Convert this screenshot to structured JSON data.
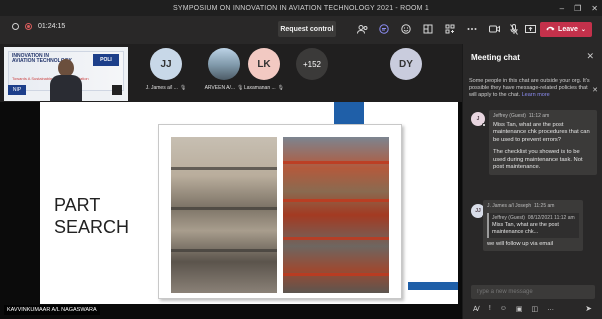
{
  "window": {
    "title": "SYMPOSIUM ON INNOVATION IN AVIATION TECHNOLOGY 2021 - ROOM 1",
    "controls": [
      "–",
      "❐",
      "✕"
    ]
  },
  "toolbar": {
    "timer": "01:24:15",
    "request_control_label": "Request control",
    "leave_label": "Leave",
    "icons": [
      "people-icon",
      "chat-icon",
      "reactions-icon",
      "rooms-icon",
      "apps-icon",
      "more-icon",
      "camera-icon",
      "mic-icon",
      "share-icon"
    ]
  },
  "self_tile": {
    "banner_title": "INNOVATION IN AVIATION TECHNOLOGY",
    "banner_logo": "POLI",
    "banner_sub": "Towards A Sustainable ... Future in Aviation",
    "logo_left": "NIP"
  },
  "participants": [
    {
      "initials": "JJ",
      "name": "J. James a/l ...",
      "color": "#c8d8e8"
    },
    {
      "initials": "",
      "name": "ARVEEN A/...",
      "color": "#9fb3c3"
    },
    {
      "initials": "LK",
      "name": "Laxamanan ...",
      "color": "#f2c9c2"
    }
  ],
  "overflow_count": "+152",
  "right_avatar": {
    "initials": "DY",
    "color": "#c9ccdd"
  },
  "slide": {
    "title_line1": "PART",
    "title_line2": "SEARCH",
    "presenter_label": "KAVVINKUMAAR A/L NAGASWARA"
  },
  "chat": {
    "header": "Meeting chat",
    "notice": "Some people in this chat are outside your org. It's possible they have message-related policies that will apply to the chat.",
    "notice_link": "Learn more",
    "messages": [
      {
        "initials": "J",
        "sender": "Jeffrey (Guest)",
        "time": "11:12 am",
        "text": "Miss Tan, what are the post maintenance chk procedures that can be used to prevent errors?",
        "text2": "The checklist you showed is to be used during maintenance task. Not post maintenance."
      },
      {
        "initials": "JJ",
        "sender": "J. James a/l Joseph",
        "time": "11:25 am",
        "quote_sender": "Jeffrey (Guest)",
        "quote_time": "08/12/2021 11:12 am",
        "quote_text": "Miss Tan, what are the post maintenance chk...",
        "text": "we will follow up via email"
      }
    ],
    "input_placeholder": "Type a new message"
  }
}
